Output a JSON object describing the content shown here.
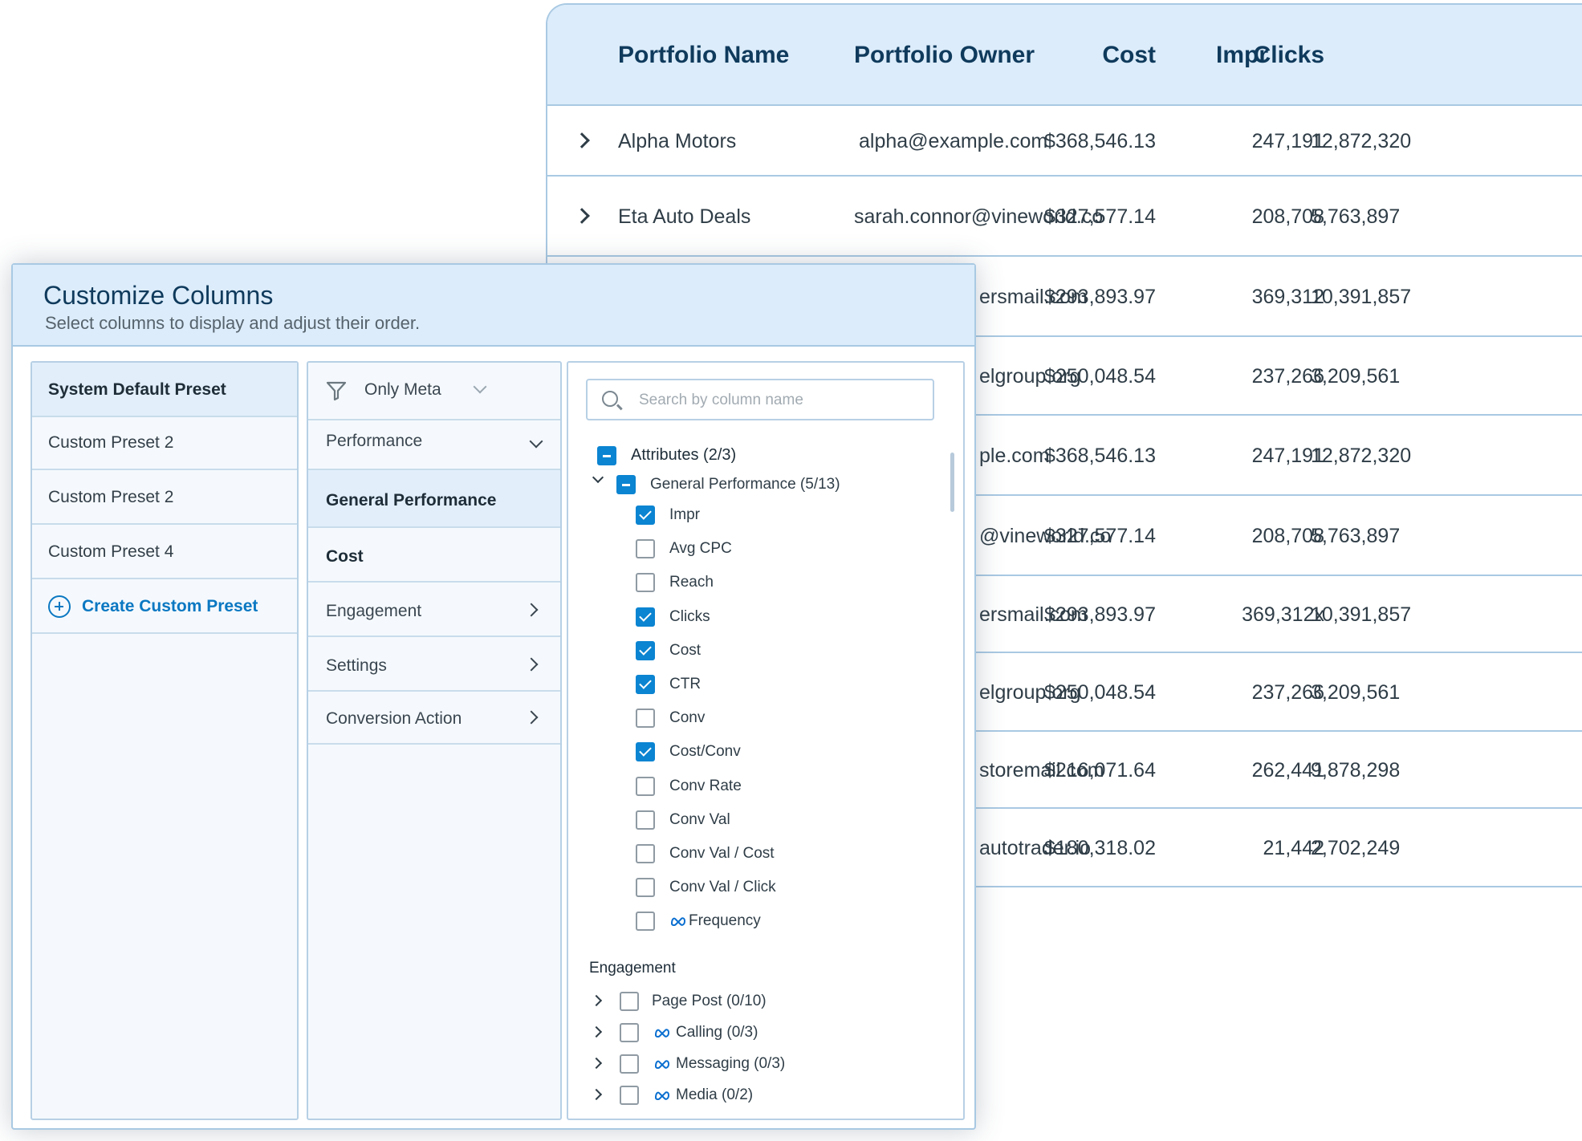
{
  "table": {
    "headers": {
      "portfolio_name": "Portfolio Name",
      "portfolio_owner": "Portfolio Owner",
      "cost": "Cost",
      "impr": "Impr",
      "clicks": "Clicks"
    },
    "rows": [
      {
        "name": "Alpha Motors",
        "owner": "alpha@example.com",
        "cost": "$368,546.13",
        "impr": "12,872,320",
        "clicks": "247,191"
      },
      {
        "name": "Eta Auto Deals",
        "owner": "sarah.connor@vineworld.co",
        "cost": "$327,577.14",
        "impr": "5,763,897",
        "clicks": "208,708"
      },
      {
        "owner": "ersmail.com",
        "cost": "$293,893.97",
        "impr": "10,391,857",
        "clicks": "369,312"
      },
      {
        "owner": "elgroup.org",
        "cost": "$250,048.54",
        "impr": "3,209,561",
        "clicks": "237,266"
      },
      {
        "owner": "ple.com",
        "cost": "$368,546.13",
        "impr": "12,872,320",
        "clicks": "247,191"
      },
      {
        "owner": "@vineworld.co",
        "cost": "$327,577.14",
        "impr": "5,763,897",
        "clicks": "208,708"
      },
      {
        "owner": "ersmail.com",
        "cost": "$293,893.97",
        "impr": "10,391,857",
        "clicks": "369,312x"
      },
      {
        "owner": "elgroup.org",
        "cost": "$250,048.54",
        "impr": "3,209,561",
        "clicks": "237,266"
      },
      {
        "owner": "storemail.com",
        "cost": "$216,071.64",
        "impr": "9,878,298",
        "clicks": "262,441"
      },
      {
        "owner": "autotrader.io",
        "cost": "$180,318.02",
        "impr": "2,702,249",
        "clicks": "21,442"
      }
    ]
  },
  "panel": {
    "title": "Customize Columns",
    "subtitle": "Select columns to display and adjust their order."
  },
  "presets": {
    "items": [
      {
        "label": "System Default Preset",
        "active": true
      },
      {
        "label": "Custom Preset 2",
        "active": false
      },
      {
        "label": "Custom Preset 2",
        "active": false
      },
      {
        "label": "Custom Preset 4",
        "active": false
      }
    ],
    "create_label": "Create Custom Preset"
  },
  "categories": {
    "filter_label": "Only Meta",
    "performance_label": "Performance",
    "items": [
      {
        "label": "General Performance"
      },
      {
        "label": "Cost"
      },
      {
        "label": "Engagement"
      },
      {
        "label": "Settings"
      },
      {
        "label": "Conversion Action"
      }
    ]
  },
  "fields": {
    "search_placeholder": "Search by column name",
    "attributes_label": "Attributes (2/3)",
    "general_label": "General Performance (5/13)",
    "items": [
      {
        "label": "Impr",
        "checked": true
      },
      {
        "label": "Avg CPC",
        "checked": false
      },
      {
        "label": "Reach",
        "checked": false
      },
      {
        "label": "Clicks",
        "checked": true
      },
      {
        "label": "Cost",
        "checked": true
      },
      {
        "label": "CTR",
        "checked": true
      },
      {
        "label": "Conv",
        "checked": false
      },
      {
        "label": "Cost/Conv",
        "checked": true
      },
      {
        "label": "Conv Rate",
        "checked": false
      },
      {
        "label": "Conv Val",
        "checked": false
      },
      {
        "label": "Conv Val / Cost",
        "checked": false
      },
      {
        "label": "Conv Val / Click",
        "checked": false
      },
      {
        "label": "Frequency",
        "checked": false,
        "icon": "meta-icon"
      }
    ],
    "engagement_heading": "Engagement",
    "engagement_items": [
      {
        "label": "Page Post (0/10)",
        "icon": ""
      },
      {
        "label": "Calling (0/3)",
        "icon": "meta-icon"
      },
      {
        "label": "Messaging (0/3)",
        "icon": "meta-icon"
      },
      {
        "label": "Media (0/2)",
        "icon": "meta-icon"
      }
    ]
  },
  "colors": {
    "accent": "#0b84d1",
    "header_bg": "#dcecfa",
    "border": "#a9c9e3",
    "title": "#0f3a5c"
  }
}
